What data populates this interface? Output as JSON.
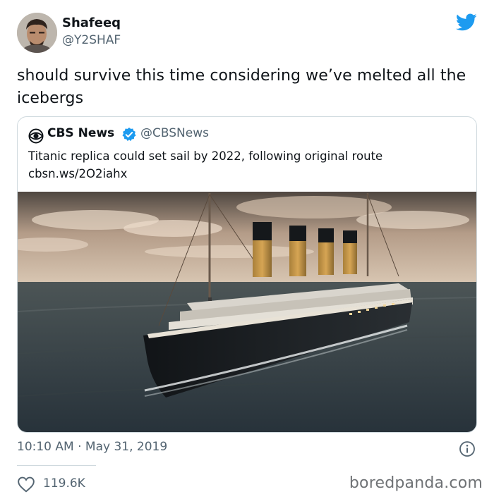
{
  "tweet": {
    "author_name": "Shafeeq",
    "author_handle": "@Y2SHAF",
    "avatar_icon": "avatar-photo",
    "brand_icon": "twitter-bird-icon",
    "brand_color": "#1d9bf0",
    "text": "should survive this time considering we’ve melted all the icebergs",
    "timestamp": "10:10 AM · May 31, 2019",
    "likes": "119.6K"
  },
  "quoted": {
    "name": "CBS News",
    "handle": "@CBSNews",
    "verified_color": "#1d9bf0",
    "text": "Titanic replica could set sail by 2022, following original route",
    "link": "cbsn.ws/2O2iahx",
    "image_icon": "ship-photo"
  },
  "watermark": "boredpanda.com"
}
